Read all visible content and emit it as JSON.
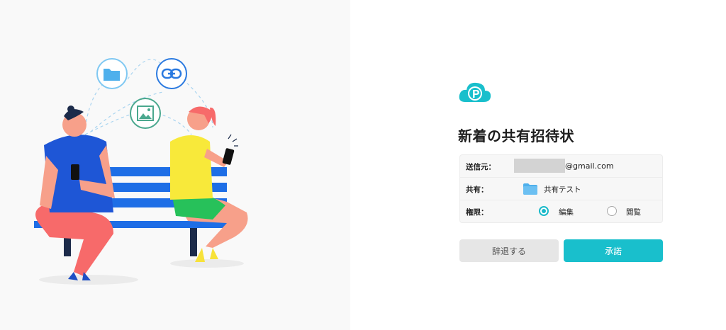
{
  "dialog": {
    "title": "新着の共有招待状",
    "sender_label": "送信元：",
    "sender_email_suffix": "@gmail.com",
    "share_label": "共有：",
    "share_folder_name": "共有テスト",
    "permission_label": "権限：",
    "permission_options": [
      {
        "label": "編集",
        "selected": true
      },
      {
        "label": "閲覧",
        "selected": false
      }
    ],
    "decline_button": "辞退する",
    "accept_button": "承諾"
  },
  "icons": {
    "logo": "pcloud-logo-icon",
    "folder": "folder-icon",
    "link": "link-icon",
    "image": "image-icon"
  },
  "colors": {
    "accent": "#19bfcc",
    "left_background": "#f9f9f9",
    "bench": "#1e6ee6"
  }
}
